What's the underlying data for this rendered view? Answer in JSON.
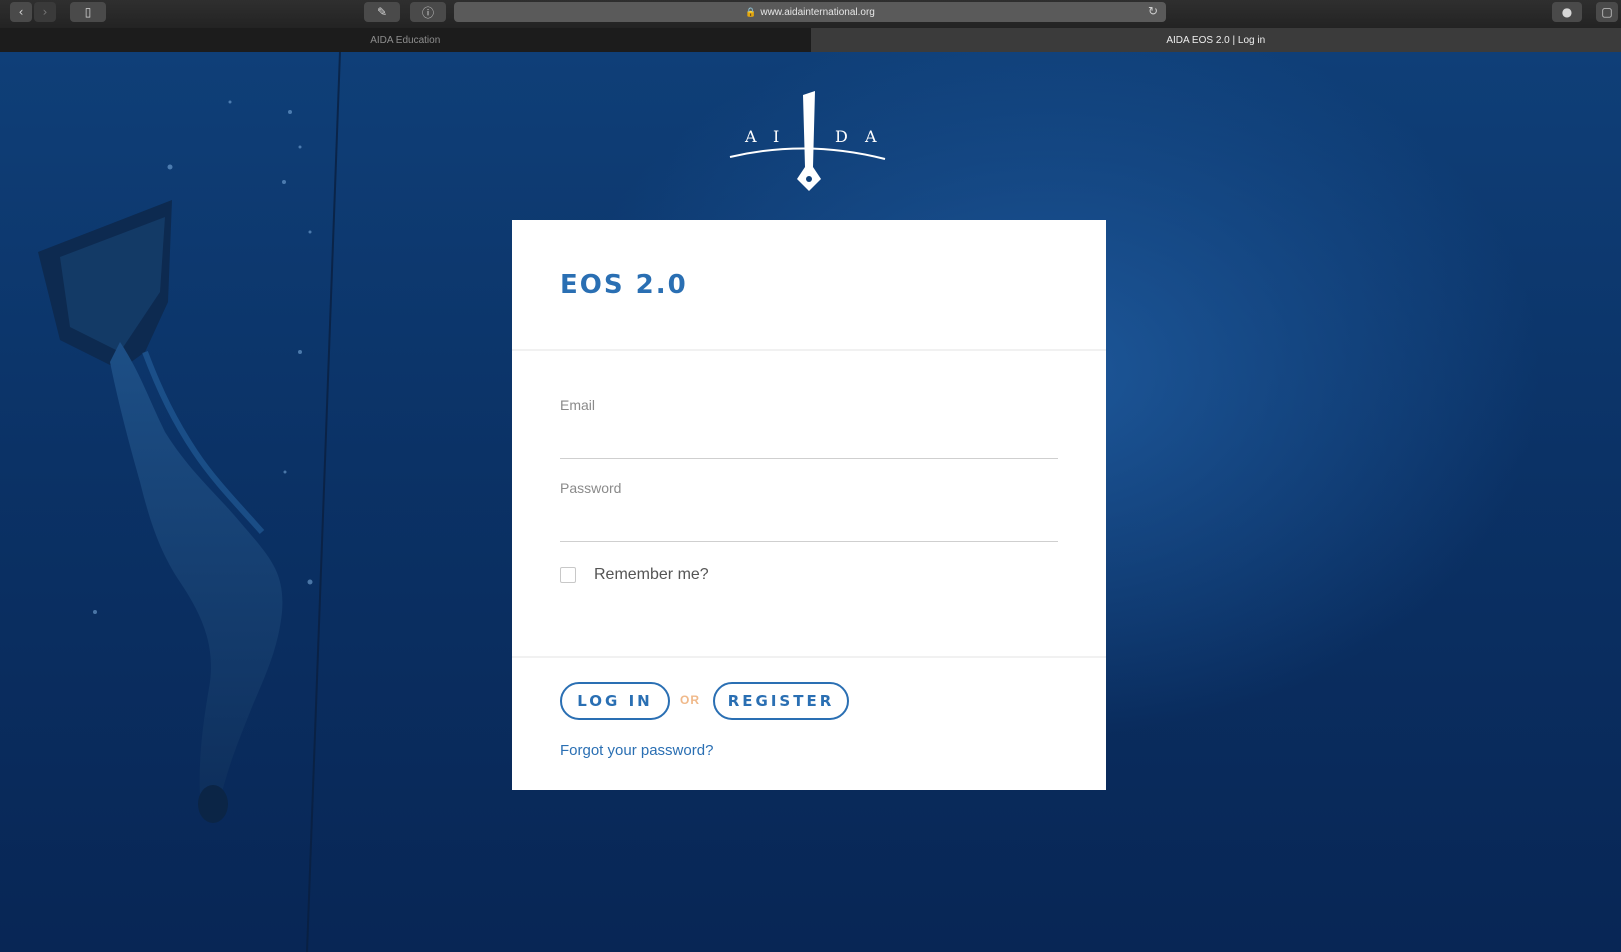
{
  "browser": {
    "address": "www.aidainternational.org",
    "tabs": [
      {
        "label": "AIDA Education"
      },
      {
        "label": "AIDA EOS 2.0 | Log in"
      }
    ]
  },
  "logo": {
    "text": "A I D A"
  },
  "login": {
    "title": "EOS 2.0",
    "email_label": "Email",
    "email_value": "",
    "password_label": "Password",
    "password_value": "",
    "remember_label": "Remember me?",
    "remember_checked": false,
    "login_button": "LOG IN",
    "or_text": "OR",
    "register_button": "REGISTER",
    "forgot_link": "Forgot your password?"
  },
  "colors": {
    "accent": "#2a6fb3",
    "or_text": "#f0b98a",
    "background_deep": "#0b2f5e"
  }
}
